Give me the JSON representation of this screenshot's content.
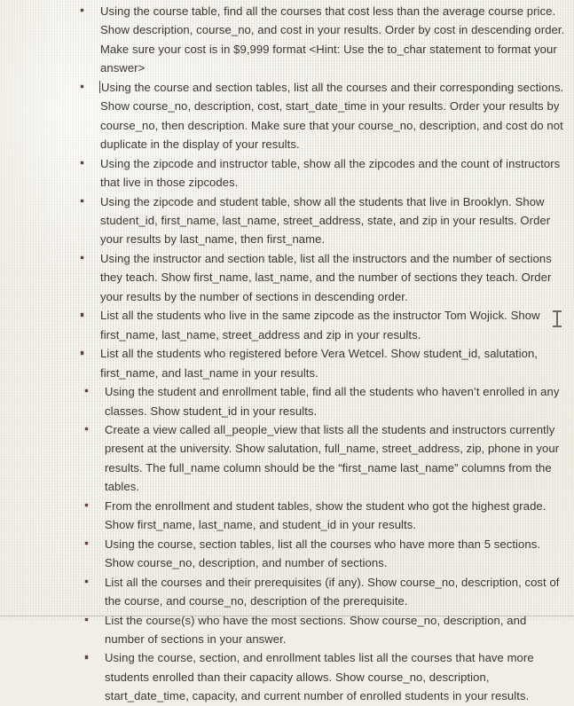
{
  "document": {
    "kind": "scanned-assignment-page",
    "background_color": "#f1eee7",
    "text_color": "#3c362f",
    "bullet_color": "#5b4038"
  },
  "cursor": {
    "mouse_pointer": "i-beam-text-cursor",
    "text_caret_in_item": 2
  },
  "list": {
    "items": [
      {
        "id": "q1-courses-below-average-price",
        "text": "Using the course table, find all the courses that cost less than the average course price.  Show description, course_no, and cost in your  results.  Order by cost in descending order.  Make sure your cost is in $9,999 format <Hint: Use the to_char statement to format your answer>",
        "indented": false,
        "caret": false
      },
      {
        "id": "q2-courses-and-sections",
        "text": "Using the course and section tables, list all the courses and their corresponding sections.  Show course_no, description, cost, start_date_time in your results.  Order your results by course_no, then description.  Make sure that your course_no, description, and cost do not duplicate in the display of your results.",
        "indented": false,
        "caret": true
      },
      {
        "id": "q3-zipcode-instructor-count",
        "text": "Using the zipcode and instructor table, show all the zipcodes and the count of instructors that live in those zipcodes.",
        "indented": false,
        "caret": false
      },
      {
        "id": "q4-students-in-brooklyn",
        "text": "Using the zipcode and student table, show all the students that live in Brooklyn.  Show student_id,  first_name, last_name, street_address, state, and zip in your results.  Order your results by last_name, then first_name.",
        "indented": false,
        "caret": false
      },
      {
        "id": "q5-instructors-section-counts",
        "text": "Using the instructor and section table, list all the instructors and the number of sections they teach.  Show first_name, last_name, and the number of sections they teach.  Order your results by the number of sections in descending order.",
        "indented": false,
        "caret": false
      },
      {
        "id": "q6-students-same-zipcode-tom-wojick",
        "text": "List all the students who live in the same zipcode as the instructor Tom Wojick.  Show first_name, last_name, street_address and zip in your results.",
        "indented": false,
        "caret": false
      },
      {
        "id": "q7-students-registered-before-vera-wetcel",
        "text": "List all the students who registered before Vera Wetcel.   Show student_id, salutation, first_name, and last_name in your results.",
        "indented": false,
        "caret": false
      },
      {
        "id": "q8-students-not-enrolled",
        "text": "Using the student and enrollment table, find all the students who haven’t enrolled in any classes. Show student_id in your results.",
        "indented": true,
        "caret": false
      },
      {
        "id": "q9-create-all-people-view",
        "text": "Create a view called all_people_view that lists all the students and instructors currently present at the university.  Show salutation, full_name, street_address, zip, phone in your results.  The full_name column should be the “first_name last_name”  columns from the tables.",
        "indented": true,
        "caret": false
      },
      {
        "id": "q10-student-highest-grade",
        "text": "From the enrollment and student tables, show the student who got the highest grade.  Show first_name, last_name, and student_id in your results.",
        "indented": true,
        "caret": false
      },
      {
        "id": "q11-courses-more-than-5-sections",
        "text": "Using the course,  section tables, list all the courses who have more than 5 sections.  Show course_no, description, and number of sections.",
        "indented": true,
        "caret": false
      },
      {
        "id": "q12-courses-and-prerequisites",
        "text": "List all the courses and their prerequisites (if any).  Show course_no, description, cost of the course, and course_no, description of the prerequisite.",
        "indented": true,
        "caret": false
      },
      {
        "id": "q13-courses-most-sections",
        "text": "List the course(s) who have the most sections.  Show course_no, description, and number of sections in your answer.",
        "indented": true,
        "caret": false
      },
      {
        "id": "q14-courses-over-capacity",
        "text": "Using the course, section, and enrollment tables list all the courses that have more students enrolled than their capacity allows.  Show course_no, description, start_date_time, capacity, and current number of enrolled students in your results.",
        "indented": true,
        "caret": false
      }
    ]
  }
}
